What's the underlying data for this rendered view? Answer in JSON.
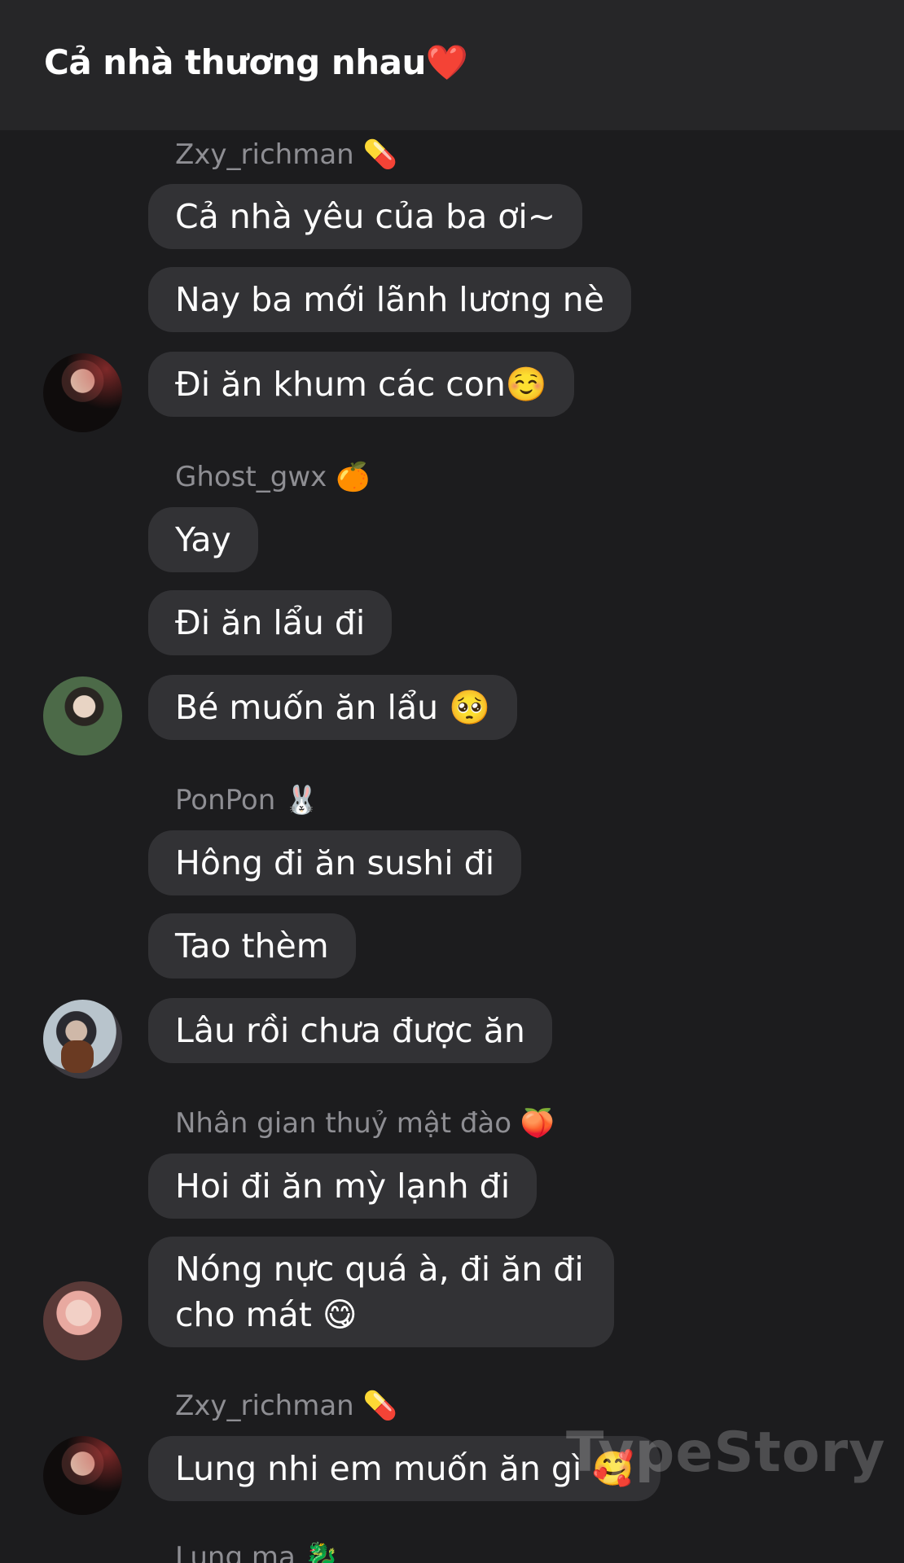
{
  "header": {
    "title": "Cả nhà thương nhau❤️"
  },
  "messages": [
    {
      "sender": "Zxy_richman 💊",
      "lines": [
        "Cả nhà yêu của ba ơi~",
        "Nay ba mới lãnh lương nè",
        "Đi ăn khum các con☺️"
      ]
    },
    {
      "sender": "Ghost_gwx 🍊",
      "lines": [
        "Yay",
        "Đi ăn lẩu đi",
        "Bé muốn ăn lẩu 🥺"
      ]
    },
    {
      "sender": "PonPon 🐰",
      "lines": [
        "Hông đi ăn sushi đi",
        "Tao thèm",
        "Lâu rồi chưa được ăn"
      ]
    },
    {
      "sender": "Nhân gian thuỷ mật đào 🍑",
      "lines": [
        "Hoi đi ăn mỳ lạnh đi",
        "Nóng nực quá à, đi ăn đi cho mát 😋"
      ]
    },
    {
      "sender": "Zxy_richman 💊",
      "lines": [
        "Lung nhi em muốn ăn gì 🥰"
      ]
    },
    {
      "sender": "Lung ma 🐉",
      "lines": []
    }
  ],
  "watermark": "TypeStory"
}
